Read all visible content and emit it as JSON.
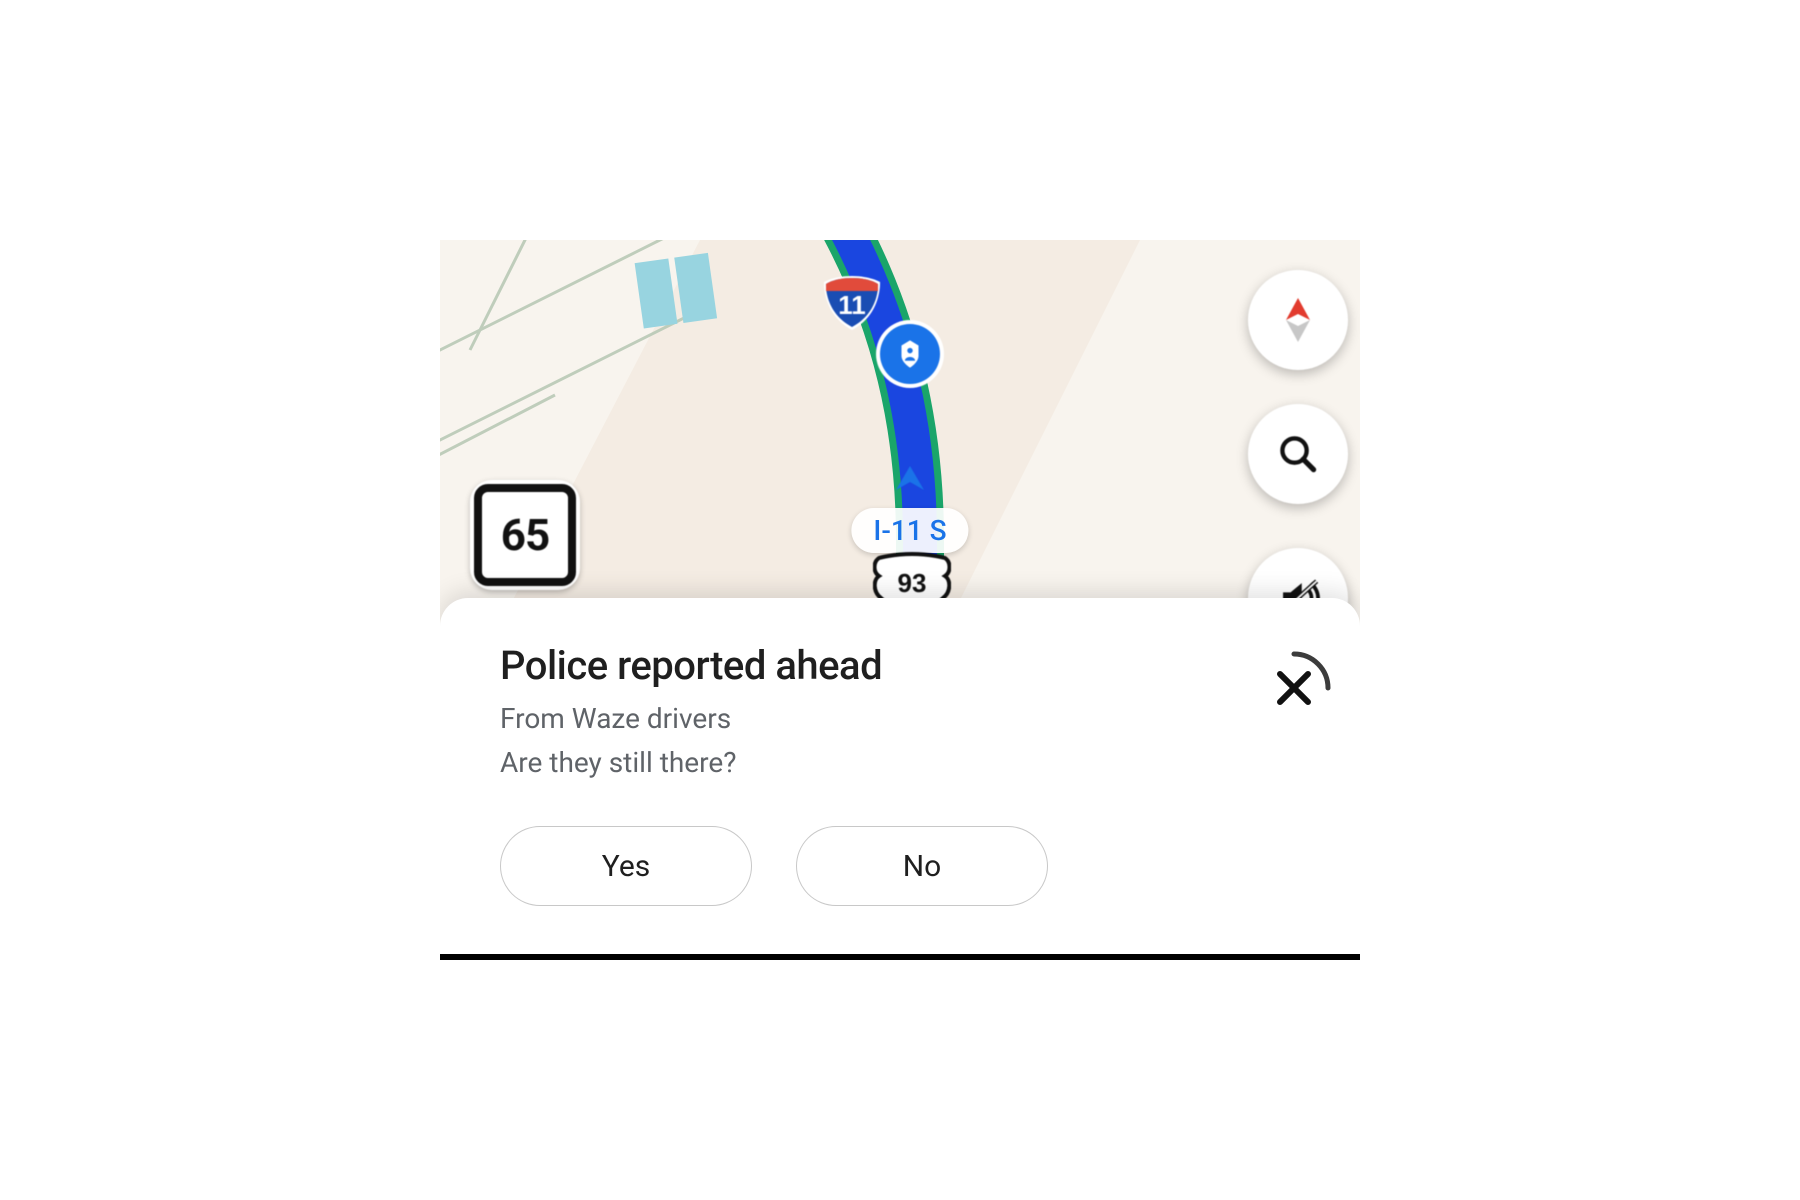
{
  "speed_limit": "65",
  "interstate_shield_number": "11",
  "road_label": "I-11 S",
  "us_route_number": "93",
  "icons": {
    "compass": "compass-icon",
    "search": "search-icon",
    "mute": "mute-icon",
    "police_badge": "police-badge-icon",
    "direction_arrow": "direction-arrow-icon",
    "close": "close-icon"
  },
  "alert": {
    "title": "Police reported ahead",
    "source_line": "From Waze drivers",
    "question_line": "Are they still there?",
    "yes_label": "Yes",
    "no_label": "No"
  },
  "colors": {
    "route_blue": "#1a56e8",
    "accent_blue": "#1a73e8",
    "land": "#f4ece3",
    "water": "#a7d9e3",
    "grey_road": "#9aa0a6",
    "shield_red": "#e14b3b",
    "compass_red": "#e23b2e"
  }
}
